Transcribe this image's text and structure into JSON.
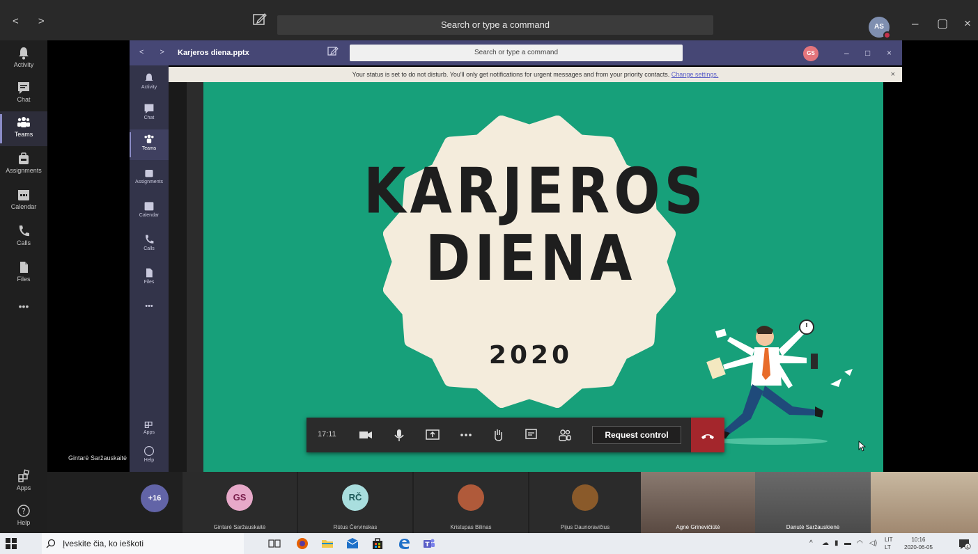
{
  "window": {
    "search_placeholder": "Search or type a command",
    "user_initials": "AS",
    "controls": {
      "minimize": "–",
      "maximize": "▢",
      "close": "×"
    },
    "nav_arrows": "< >"
  },
  "left_rail": [
    {
      "label": "Activity",
      "icon": "bell-icon"
    },
    {
      "label": "Chat",
      "icon": "chat-icon"
    },
    {
      "label": "Teams",
      "icon": "teams-icon"
    },
    {
      "label": "Assignments",
      "icon": "assignments-icon"
    },
    {
      "label": "Calendar",
      "icon": "calendar-icon"
    },
    {
      "label": "Calls",
      "icon": "phone-icon"
    },
    {
      "label": "Files",
      "icon": "file-icon"
    },
    {
      "label": "•••",
      "icon": "more-icon"
    }
  ],
  "left_rail_bottom": [
    {
      "label": "Apps",
      "icon": "apps-icon"
    },
    {
      "label": "Help",
      "icon": "help-icon"
    }
  ],
  "shared_screen": {
    "title": "Karjeros diena.pptx",
    "search_placeholder": "Search or type a command",
    "user_initials": "GS",
    "nav_arrows": "< >",
    "notice": "Your status is set to do not disturb. You'll only get notifications for urgent messages and from your priority contacts.",
    "notice_link": "Change settings.",
    "rail": [
      "Activity",
      "Chat",
      "Teams",
      "Assignments",
      "Calendar",
      "Calls",
      "Files",
      "•••"
    ],
    "rail_bottom": [
      "Apps",
      "Help"
    ]
  },
  "slide": {
    "title_line1": "KARJEROS",
    "title_line2": "DIENA",
    "year": "2020",
    "colors": {
      "background": "#17a07a",
      "badge": "#f4ecdc",
      "text": "#1e1e1e"
    }
  },
  "call_toolbar": {
    "timer": "17:11",
    "request_control": "Request control"
  },
  "presenter_name": "Gintarė Saržauskaitė",
  "participants": {
    "overflow": "+16",
    "tiles": [
      {
        "initials": "GS",
        "name": "Gintarė Saržauskaitė",
        "color": "#e7a9c9",
        "text_color": "#7a1f4c"
      },
      {
        "initials": "RČ",
        "name": "Rūtus Červinskas",
        "color": "#a9dede",
        "text_color": "#1c5a5a"
      },
      {
        "initials": "",
        "name": "Kristupas Bilinas",
        "color": "#b05a3a",
        "text_color": "#fff"
      },
      {
        "initials": "",
        "name": "Pijus Daunoravičius",
        "color": "#8a5a2a",
        "text_color": "#fff"
      },
      {
        "initials": "",
        "name": "Agnė Grinevičiūtė",
        "color": "#6a5a50",
        "text_color": "#fff"
      },
      {
        "initials": "",
        "name": "Danutė Saržauskienė",
        "color": "#5a5a5a",
        "text_color": "#fff"
      }
    ]
  },
  "taskbar": {
    "search_text": "Įveskite čia, ko ieškoti",
    "lang": "LIT\nLT",
    "time": "10:16",
    "date": "2020-06-05"
  }
}
